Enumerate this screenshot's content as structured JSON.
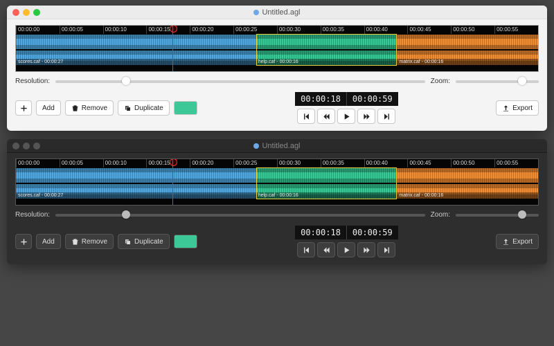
{
  "windows": [
    {
      "theme": "light",
      "title": "Untitled.agl"
    },
    {
      "theme": "dark",
      "title": "Untitled.agl"
    }
  ],
  "ruler": [
    "00:00:00",
    "00:00:05",
    "00:00:10",
    "00:00:15",
    "00:00:20",
    "00:00:25",
    "00:00:30",
    "00:00:35",
    "00:00:40",
    "00:00:45",
    "00:00:50",
    "00:00:55"
  ],
  "clips": [
    {
      "name": "scores.caf",
      "dur": "00:00:27",
      "color": "blue",
      "start_pct": 0,
      "width_pct": 46
    },
    {
      "name": "help.caf",
      "dur": "00:00:16",
      "color": "green",
      "start_pct": 46,
      "width_pct": 27,
      "selected": true
    },
    {
      "name": "matrix.caf",
      "dur": "00:00:16",
      "color": "orange",
      "start_pct": 73,
      "width_pct": 27
    }
  ],
  "playhead_pct": 30,
  "sliders": {
    "resolution_label": "Resolution:",
    "resolution_pos_pct": 18,
    "zoom_label": "Zoom:",
    "zoom_pos_pct": 75
  },
  "toolbar": {
    "add": "Add",
    "remove": "Remove",
    "duplicate": "Duplicate",
    "export": "Export"
  },
  "time": {
    "current": "00:00:18",
    "total": "00:00:59"
  }
}
